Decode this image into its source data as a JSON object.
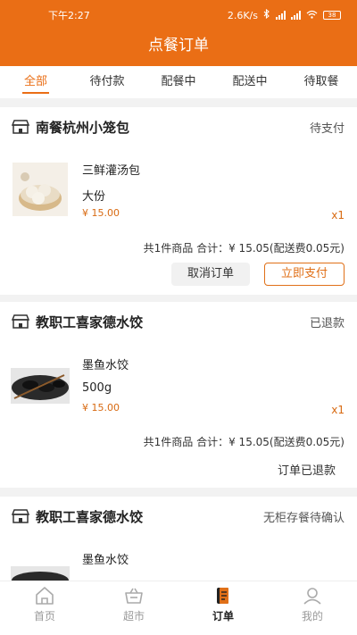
{
  "status_bar": {
    "time": "下午2:27",
    "net_speed": "2.6K/s",
    "battery": "38"
  },
  "header": {
    "title": "点餐订单"
  },
  "tabs": [
    {
      "label": "全部",
      "active": true
    },
    {
      "label": "待付款",
      "active": false
    },
    {
      "label": "配餐中",
      "active": false
    },
    {
      "label": "配送中",
      "active": false
    },
    {
      "label": "待取餐",
      "active": false
    }
  ],
  "orders": [
    {
      "shop": "南餐杭州小笼包",
      "status": "待支付",
      "item": {
        "name": "三鲜灌汤包",
        "spec": "大份",
        "price": "¥ 15.00",
        "qty": "x1",
        "thumb": "dumpling-steamer-photo"
      },
      "summary": "共1件商品  合计：¥ 15.05(配送费0.05元)",
      "actions": {
        "cancel": "取消订单",
        "pay": "立即支付"
      }
    },
    {
      "shop": "教职工喜家德水饺",
      "status": "已退款",
      "item": {
        "name": "墨鱼水饺",
        "spec": "500g",
        "price": "¥ 15.00",
        "qty": "x1",
        "thumb": "black-dumpling-photo"
      },
      "summary": "共1件商品  合计：¥ 15.05(配送费0.05元)",
      "status_text": "订单已退款"
    },
    {
      "shop": "教职工喜家德水饺",
      "status": "无柜存餐待确认",
      "item": {
        "name": "墨鱼水饺",
        "thumb": "black-dumpling-photo"
      }
    }
  ],
  "bottom_nav": [
    {
      "label": "首页",
      "icon": "home-icon",
      "active": false
    },
    {
      "label": "超市",
      "icon": "basket-icon",
      "active": false
    },
    {
      "label": "订单",
      "icon": "order-scroll-icon",
      "active": true
    },
    {
      "label": "我的",
      "icon": "profile-icon",
      "active": false
    }
  ],
  "colors": {
    "accent": "#ea6e15",
    "price": "#d86a12",
    "background": "#f2f2f2"
  }
}
